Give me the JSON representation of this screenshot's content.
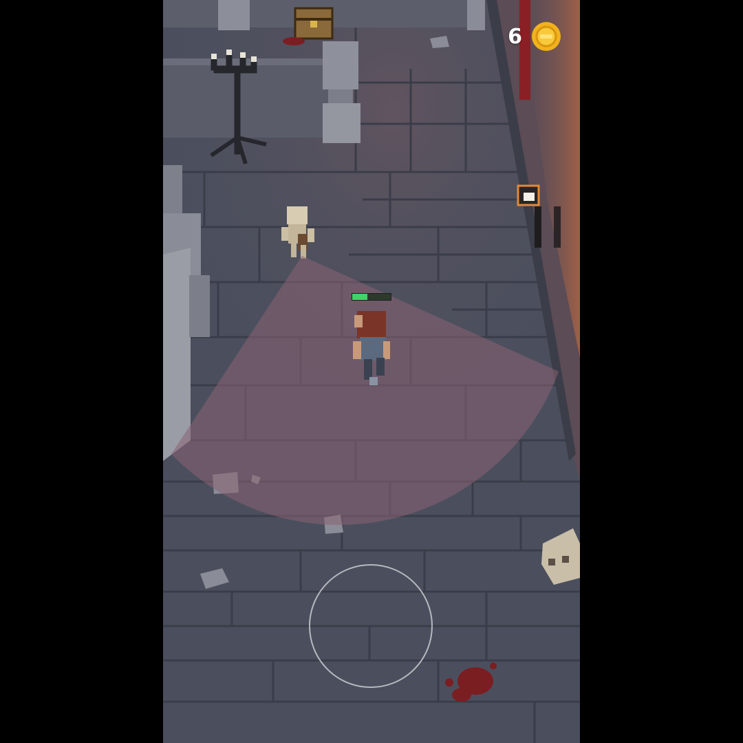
{
  "hud": {
    "coins": "6",
    "coin_icon": "gold-coin-icon"
  },
  "player": {
    "health_fraction": 0.4
  },
  "colors": {
    "floor": "#4a4e5c",
    "vision_cone": "#8a6272",
    "health": "#3fd36a",
    "coin": "#f2b21c",
    "torch_glow": "#d9703a"
  }
}
